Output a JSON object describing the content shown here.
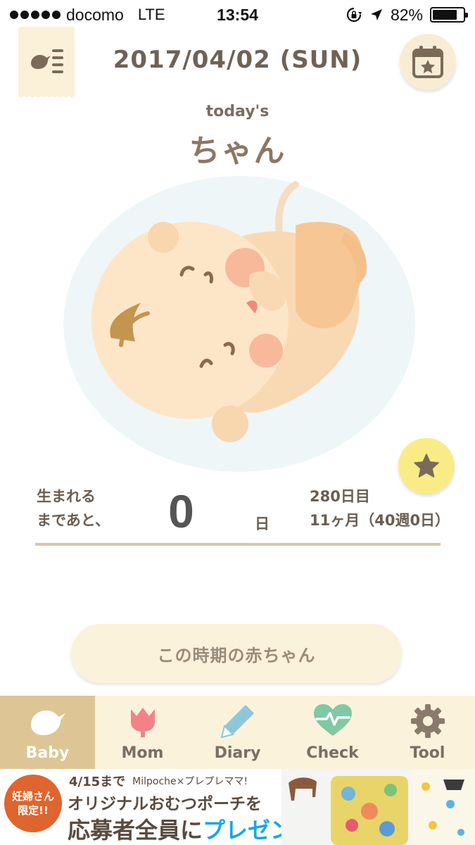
{
  "status_bar": {
    "carrier": "docomo",
    "network": "LTE",
    "time": "13:54",
    "battery": "82%",
    "battery_level": 0.82
  },
  "header": {
    "date": "2017/04/02 (SUN)",
    "menu_icon": "bird-list-icon",
    "calendar_icon": "calendar-star-icon"
  },
  "baby": {
    "subtitle": "today's",
    "name": "ちゃん"
  },
  "countdown": {
    "label_line1": "生まれる",
    "label_line2": "まであと、",
    "days": "0",
    "unit": "日",
    "day_count": "280日目",
    "age": "11ヶ月（40週0日）",
    "progress": 1.0
  },
  "info_button": {
    "label": "この時期の赤ちゃん"
  },
  "tabs": [
    {
      "label": "Baby",
      "icon": "bird-icon",
      "active": true
    },
    {
      "label": "Mom",
      "icon": "tulip-icon",
      "active": false
    },
    {
      "label": "Diary",
      "icon": "pencil-icon",
      "active": false
    },
    {
      "label": "Check",
      "icon": "heart-pulse-icon",
      "active": false
    },
    {
      "label": "Tool",
      "icon": "gear-icon",
      "active": false
    }
  ],
  "ad": {
    "badge_line1": "妊婦さん",
    "badge_line2": "限定!!",
    "deadline": "4/15まで",
    "brand": "Milpoche×プレプレママ!",
    "line2": "オリジナルおむつポーチを",
    "line3_prefix": "応募者全員に",
    "line3_highlight": "プレゼント"
  },
  "colors": {
    "cream": "#fbf2dc",
    "tab_active": "#ddc596",
    "text_brown": "#6b5d50",
    "accent_yellow": "#f9ec86",
    "ad_orange": "#e0642d",
    "ad_blue": "#18a7e6"
  }
}
